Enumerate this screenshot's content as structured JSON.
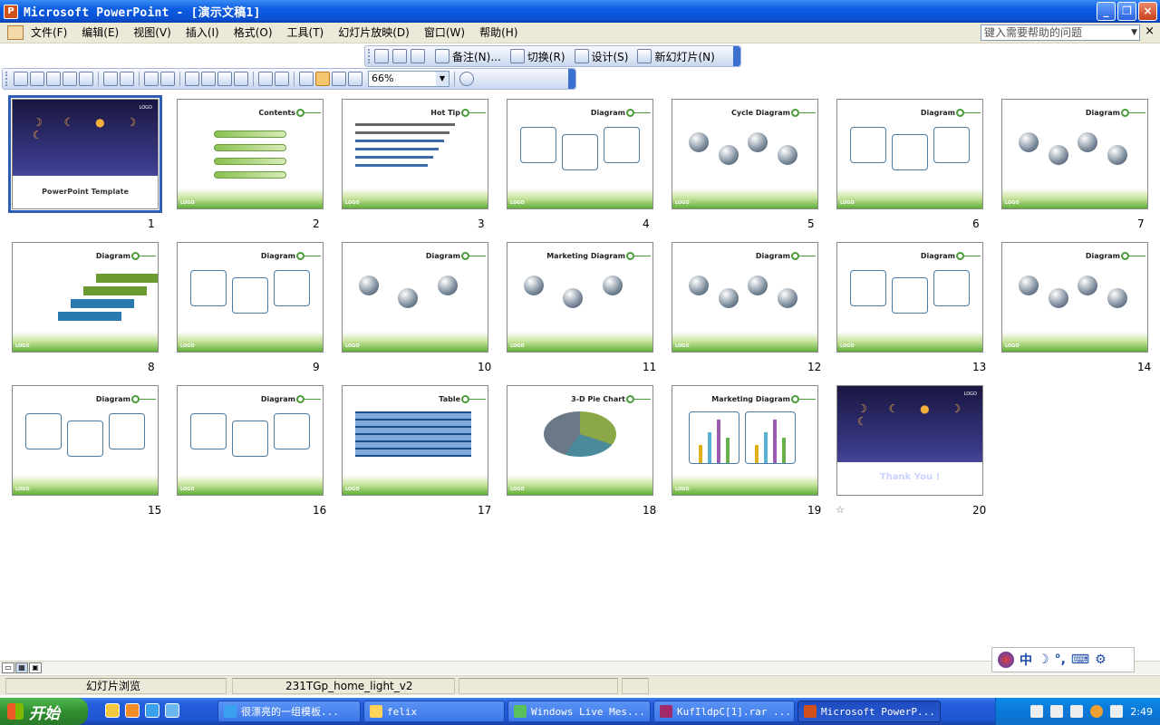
{
  "window": {
    "title": "Microsoft PowerPoint - [演示文稿1]",
    "app_icon": "powerpoint-icon",
    "controls": [
      "_",
      "❐",
      "×"
    ]
  },
  "menubar": {
    "items": [
      "文件(F)",
      "编辑(E)",
      "视图(V)",
      "插入(I)",
      "格式(O)",
      "工具(T)",
      "幻灯片放映(D)",
      "窗口(W)",
      "帮助(H)"
    ],
    "help_placeholder": "键入需要帮助的问题",
    "close": "×"
  },
  "toolbar_sorter": {
    "notes": "备注(N)...",
    "transition": "切换(R)",
    "design": "设计(S)",
    "new_slide": "新幻灯片(N)"
  },
  "toolbar_standard": {
    "zoom": "66%"
  },
  "slides": [
    {
      "n": "1",
      "type": "title",
      "title": "PowerPoint Template",
      "selected": true
    },
    {
      "n": "2",
      "type": "contents",
      "title": "Contents"
    },
    {
      "n": "3",
      "type": "text",
      "title": "Hot Tip"
    },
    {
      "n": "4",
      "type": "diagram-a",
      "title": "Diagram"
    },
    {
      "n": "5",
      "type": "cycle",
      "title": "Cycle Diagram"
    },
    {
      "n": "6",
      "type": "diagram-b",
      "title": "Diagram"
    },
    {
      "n": "7",
      "type": "diagram-c",
      "title": "Diagram"
    },
    {
      "n": "8",
      "type": "stairs",
      "title": "Diagram"
    },
    {
      "n": "9",
      "type": "diagram-d",
      "title": "Diagram"
    },
    {
      "n": "10",
      "type": "diagram-e",
      "title": "Diagram"
    },
    {
      "n": "11",
      "type": "marketing",
      "title": "Marketing Diagram"
    },
    {
      "n": "12",
      "type": "hub",
      "title": "Diagram"
    },
    {
      "n": "13",
      "type": "columns",
      "title": "Diagram"
    },
    {
      "n": "14",
      "type": "timeline",
      "title": "Diagram"
    },
    {
      "n": "15",
      "type": "list",
      "title": "Diagram"
    },
    {
      "n": "16",
      "type": "history",
      "title": "Diagram"
    },
    {
      "n": "17",
      "type": "table",
      "title": "Table"
    },
    {
      "n": "18",
      "type": "pie",
      "title": "3-D Pie Chart"
    },
    {
      "n": "19",
      "type": "bars",
      "title": "Marketing Diagram"
    },
    {
      "n": "20",
      "type": "thanks",
      "title": "Thank You !"
    }
  ],
  "status": {
    "view": "幻灯片浏览",
    "template": "231TGp_home_light_v2"
  },
  "language_bar": [
    "中",
    "☽",
    "°,",
    "⌨",
    "⚙"
  ],
  "taskbar": {
    "start": "开始",
    "tasks": [
      {
        "label": "很漂亮的一组模板...",
        "active": false
      },
      {
        "label": "felix",
        "active": false
      },
      {
        "label": "Windows Live Mes...",
        "active": false
      },
      {
        "label": "KufIldpC[1].rar ...",
        "active": false
      },
      {
        "label": "Microsoft PowerP...",
        "active": true
      }
    ],
    "clock": "2:49"
  }
}
